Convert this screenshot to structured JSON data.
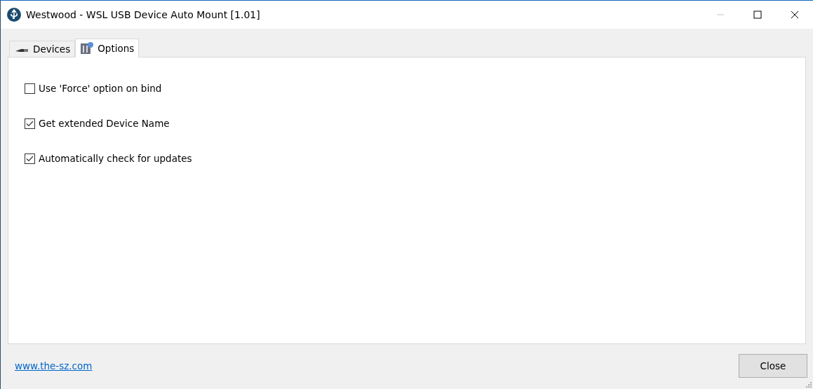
{
  "window": {
    "title": "Westwood - WSL USB Device Auto Mount [1.01]"
  },
  "tabs": [
    {
      "label": "Devices",
      "selected": false,
      "kind": "plug"
    },
    {
      "label": "Options",
      "selected": true,
      "kind": "settings"
    }
  ],
  "options": [
    {
      "label": "Use 'Force' option on bind",
      "checked": false
    },
    {
      "label": "Get extended Device Name",
      "checked": true
    },
    {
      "label": "Automatically check for updates",
      "checked": true
    }
  ],
  "footer": {
    "link": "www.the-sz.com",
    "button": "Close"
  }
}
